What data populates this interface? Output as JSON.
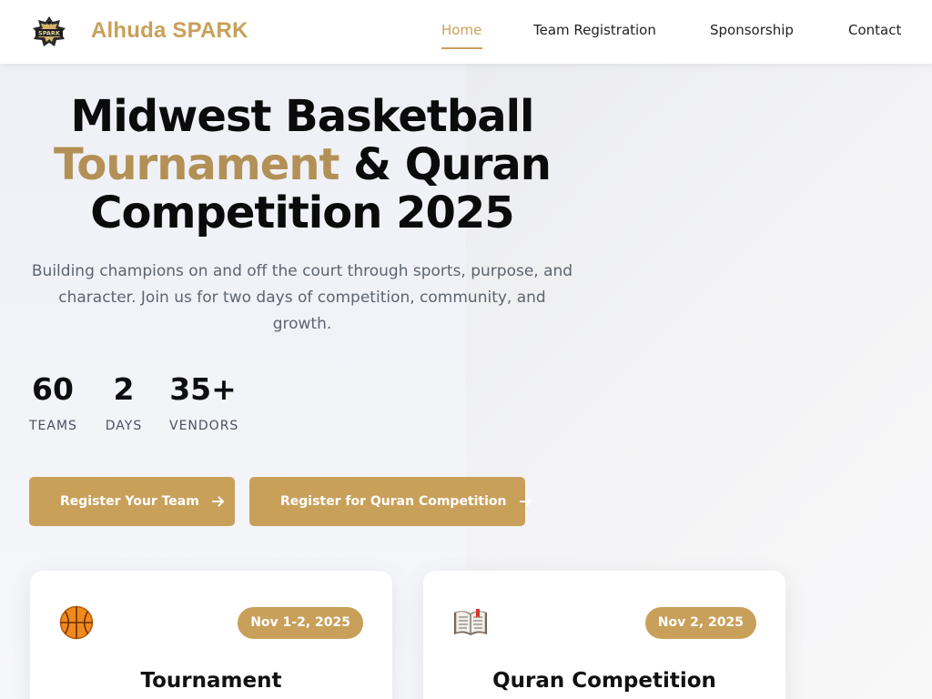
{
  "brand": {
    "name": "Alhuda SPARK",
    "logo_icon": "spark-crest-logo"
  },
  "nav": {
    "items": [
      {
        "label": "Home",
        "active": true
      },
      {
        "label": "Team Registration",
        "active": false
      },
      {
        "label": "Sponsorship",
        "active": false
      },
      {
        "label": "Contact",
        "active": false
      }
    ]
  },
  "hero": {
    "title_line1": "Midwest Basketball",
    "title_accent": "Tournament",
    "title_line2_rest": " & Quran",
    "title_line3": "Competition 2025",
    "subtitle": "Building champions on and off the court through sports, purpose, and character. Join us for two days of competition, community, and growth."
  },
  "stats": [
    {
      "value": "60",
      "label": "TEAMS"
    },
    {
      "value": "2",
      "label": "DAYS"
    },
    {
      "value": "35+",
      "label": "VENDORS"
    }
  ],
  "buttons": {
    "register_team": "Register Your Team",
    "register_quran": "Register for Quran Competition",
    "arrow_icon": "arrow-right-icon"
  },
  "cards": [
    {
      "icon": "basketball-icon",
      "badge": "Nov 1-2, 2025",
      "title": "Tournament"
    },
    {
      "icon": "open-book-icon",
      "badge": "Nov 2, 2025",
      "title": "Quran Competition"
    }
  ],
  "colors": {
    "accent": "#c9a05a",
    "title_accent": "#b39055",
    "text": "#111111",
    "muted": "#5d6470"
  }
}
